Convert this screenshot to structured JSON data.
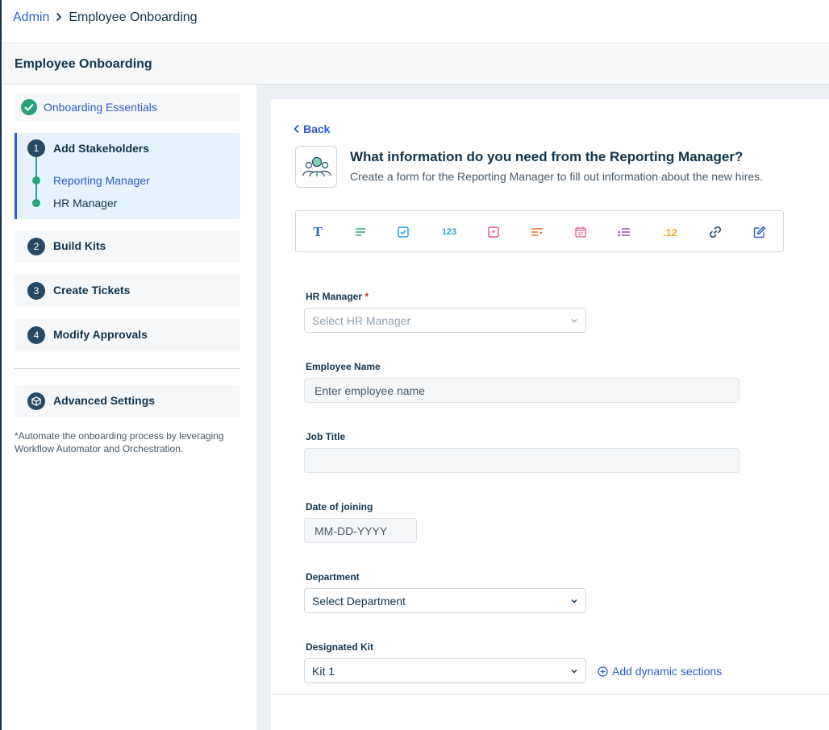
{
  "breadcrumb": {
    "root": "Admin",
    "current": "Employee Onboarding"
  },
  "page": {
    "title": "Employee Onboarding"
  },
  "sidebar": {
    "essentials": {
      "label": "Onboarding Essentials"
    },
    "steps": [
      {
        "num": "1",
        "label": "Add Stakeholders",
        "subitems": [
          "Reporting Manager",
          "HR Manager"
        ]
      },
      {
        "num": "2",
        "label": "Build Kits"
      },
      {
        "num": "3",
        "label": "Create Tickets"
      },
      {
        "num": "4",
        "label": "Modify Approvals"
      }
    ],
    "advanced": {
      "label": "Advanced Settings"
    },
    "note": "*Automate the onboarding process by leveraging Workflow Automator and Orchestration."
  },
  "main": {
    "back_label": "Back",
    "title": "What information do you need from the Reporting Manager?",
    "subtitle": "Create a form for the Reporting Manager to fill out information about the new hires.",
    "toolbar": [
      {
        "icon": "text-icon",
        "glyph": "T",
        "color": "#2c5cc5"
      },
      {
        "icon": "paragraph-icon",
        "glyph": "",
        "color": "#2aa37c"
      },
      {
        "icon": "checkbox-icon",
        "glyph": "",
        "color": "#2c9fd8"
      },
      {
        "icon": "number-icon",
        "glyph": "123",
        "color": "#2c9fd8"
      },
      {
        "icon": "dropdown-icon",
        "glyph": "",
        "color": "#e05590"
      },
      {
        "icon": "dependent-field-icon",
        "glyph": "",
        "color": "#e8702a"
      },
      {
        "icon": "date-icon",
        "glyph": "",
        "color": "#e05590"
      },
      {
        "icon": "multiselect-icon",
        "glyph": "",
        "color": "#9b4dc9"
      },
      {
        "icon": "decimal-icon",
        "glyph": ".12",
        "color": "#f5a623"
      },
      {
        "icon": "link-icon",
        "glyph": "",
        "color": "#264966"
      },
      {
        "icon": "edit-icon",
        "glyph": "",
        "color": "#2c5cc5"
      }
    ],
    "fields": {
      "hr_manager": {
        "label": "HR Manager",
        "required_mark": "*",
        "placeholder": "Select HR Manager"
      },
      "employee_name": {
        "label": "Employee Name",
        "placeholder": "Enter employee name"
      },
      "job_title": {
        "label": "Job Title",
        "value": ""
      },
      "date_of_joining": {
        "label": "Date of joining",
        "placeholder": "MM-DD-YYYY"
      },
      "department": {
        "label": "Department",
        "value": "Select Department"
      },
      "designated_kit": {
        "label": "Designated Kit",
        "value": "Kit 1"
      }
    },
    "add_dynamic_label": "Add dynamic sections"
  },
  "colors": {
    "accent": "#2c5cc5",
    "success": "#2aa37c",
    "dark": "#264966",
    "active_bg": "#e5f2fd"
  }
}
